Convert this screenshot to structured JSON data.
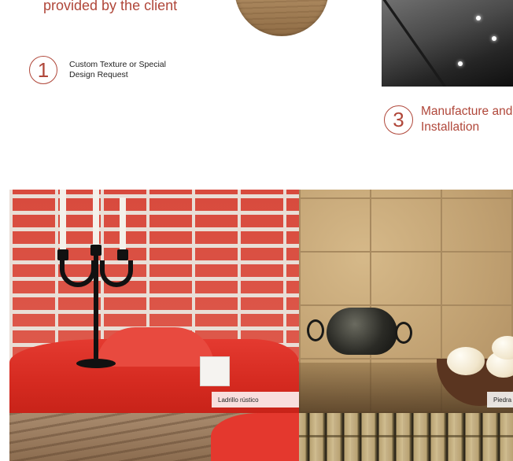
{
  "header": {
    "headline_fragment": "provided by the client"
  },
  "steps": [
    {
      "number": "1",
      "text": "Custom Texture or Special Design Request"
    },
    {
      "number": "3",
      "text": "Manufacture and Installation"
    }
  ],
  "photos": {
    "brick_caption": "Ladrillo rústico",
    "stone_caption": "Piedra"
  },
  "colors": {
    "accent": "#b0473a"
  }
}
